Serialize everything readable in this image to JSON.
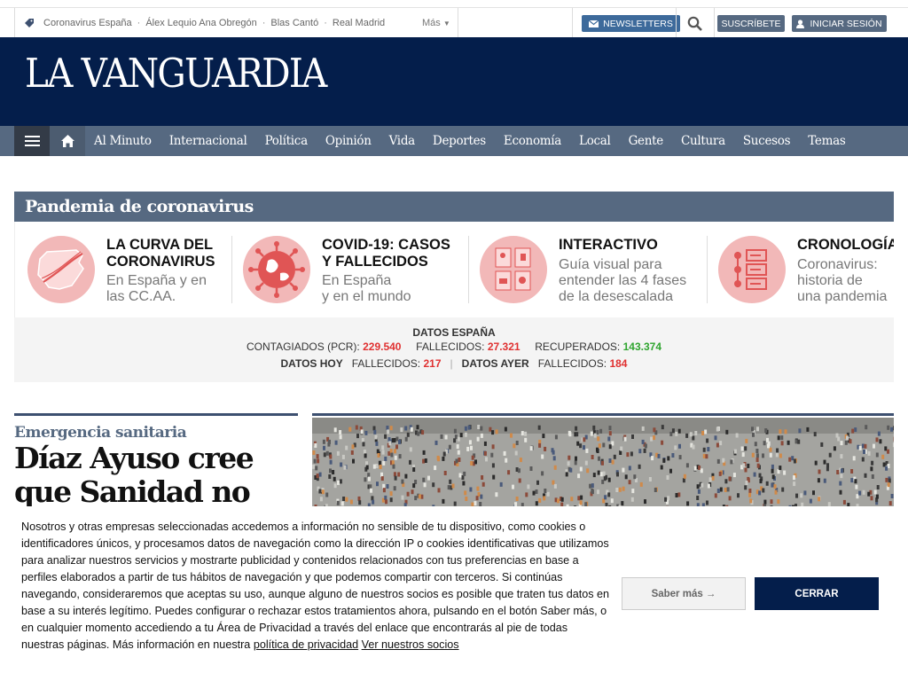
{
  "topbar": {
    "trends": [
      "Coronavirus España",
      "Álex Lequio Ana Obregón",
      "Blas Cantó",
      "Real Madrid"
    ],
    "more": "Más",
    "newsletters": "NEWSLETTERS",
    "subscribe": "SUSCRÍBETE",
    "login": "INICIAR SESIÓN"
  },
  "logo": "LA VANGUARDIA",
  "nav": {
    "items": [
      "Al Minuto",
      "Internacional",
      "Política",
      "Opinión",
      "Vida",
      "Deportes",
      "Economía",
      "Local",
      "Gente",
      "Cultura",
      "Sucesos",
      "Temas"
    ]
  },
  "pandemic": {
    "title": "Pandemia de coronavirus",
    "cards": [
      {
        "title_1": "LA CURVA DEL",
        "title_2": "CORONAVIRUS",
        "sub_1": "En España y en",
        "sub_2": "las CC.AA."
      },
      {
        "title_1": "COVID-19: CASOS",
        "title_2": "Y FALLECIDOS",
        "sub_1": "En España",
        "sub_2": "y en el mundo"
      },
      {
        "title_1": "INTERACTIVO",
        "sub_1": "Guía visual para",
        "sub_2": "entender las 4 fases",
        "sub_3": "de la desescalada"
      },
      {
        "title_1": "CRONOLOGÍA",
        "sub_1": "Coronavirus:",
        "sub_2": "historia de",
        "sub_3": "una pandemia"
      }
    ],
    "stats": {
      "heading": "DATOS ESPAÑA",
      "infected_label": "CONTAGIADOS (PCR):",
      "infected": "229.540",
      "deaths_label": "FALLECIDOS:",
      "deaths": "27.321",
      "recovered_label": "RECUPERADOS:",
      "recovered": "143.374",
      "today_label": "DATOS HOY",
      "today_deaths_label": "FALLECIDOS:",
      "today_deaths": "217",
      "yesterday_label": "DATOS AYER",
      "yesterday_deaths_label": "FALLECIDOS:",
      "yesterday_deaths": "184"
    }
  },
  "article": {
    "kicker": "Emergencia sanitaria",
    "headline_1": "Díaz Ayuso cree",
    "headline_2": "que Sanidad no"
  },
  "cookie": {
    "text": "Nosotros y otras empresas seleccionadas accedemos a información no sensible de tu dispositivo, como cookies o identificadores únicos, y procesamos datos de navegación como la dirección IP o cookies identificativas que utilizamos para analizar nuestros servicios y mostrarte publicidad y contenidos relacionados con tus preferencias en base a perfiles elaborados a partir de tus hábitos de navegación y que podemos compartir con terceros. Si continúas navegando, consideraremos que aceptas su uso, aunque alguno de nuestros socios es posible que traten tus datos en base a su interés legítimo. Puedes configurar o rechazar estos tratamientos ahora, pulsando en el botón Saber más, o en cualquier momento accediendo a tu Área de Privacidad a través del enlace que encontrarás al pie de todas nuestras páginas. Más información en nuestra",
    "privacy_link": "política de privacidad",
    "partners_link": "Ver nuestros socios",
    "more_button": "Saber más →",
    "close_button": "CERRAR"
  }
}
